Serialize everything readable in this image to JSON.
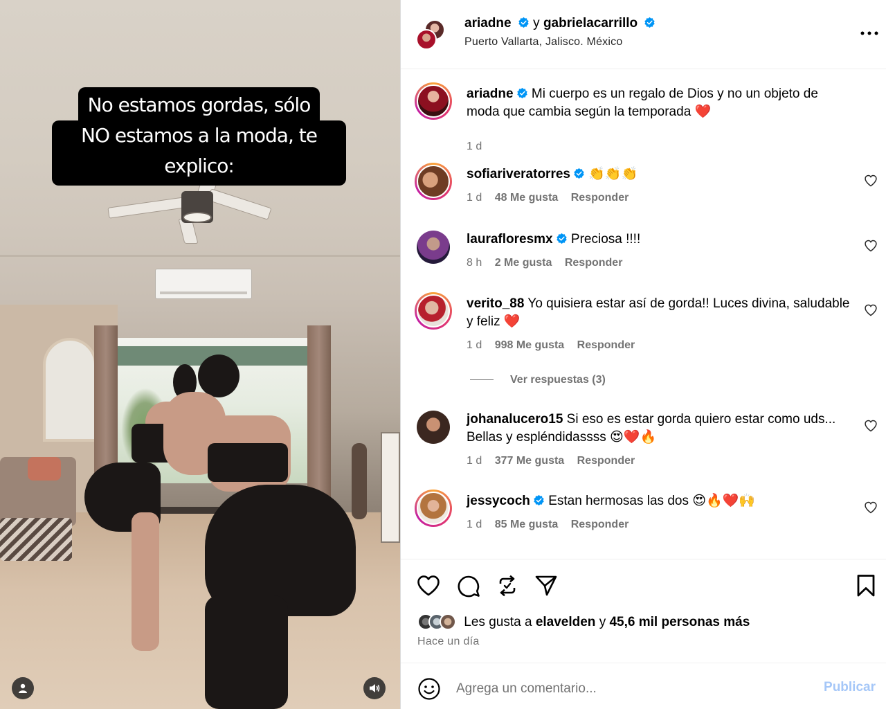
{
  "media": {
    "overlay_line1": "No estamos gordas, sólo",
    "overlay_line2": "NO estamos a la moda, te explico:"
  },
  "header": {
    "user1": "ariadne",
    "connector": "y",
    "user2": "gabrielacarrillo",
    "location": "Puerto Vallarta, Jalisco. México"
  },
  "caption": {
    "user": "ariadne",
    "text": "Mi cuerpo es un regalo de Dios y no un objeto de moda que cambia según la temporada ❤️",
    "time": "1 d"
  },
  "comments": [
    {
      "user": "sofiariveratorres",
      "verified": true,
      "text": "👏👏👏",
      "time": "1 d",
      "likes": "48 Me gusta",
      "reply": "Responder"
    },
    {
      "user": "laurafloresmx",
      "verified": true,
      "text": "Preciosa !!!!",
      "time": "8 h",
      "likes": "2 Me gusta",
      "reply": "Responder"
    },
    {
      "user": "verito_88",
      "verified": false,
      "text": "Yo quisiera estar así de gorda!! Luces divina, saludable y feliz ❤️",
      "time": "1 d",
      "likes": "998 Me gusta",
      "reply": "Responder",
      "view_replies": "Ver respuestas (3)"
    },
    {
      "user": "johanalucero15",
      "verified": false,
      "text": "Si eso es estar gorda quiero estar como uds... Bellas y espléndidassss 😍❤️🔥",
      "time": "1 d",
      "likes": "377 Me gusta",
      "reply": "Responder"
    },
    {
      "user": "jessycoch",
      "verified": true,
      "text": "Estan hermosas las dos 😍🔥❤️🙌",
      "time": "1 d",
      "likes": "85 Me gusta",
      "reply": "Responder"
    }
  ],
  "likes": {
    "prefix": "Les gusta a",
    "user": "elavelden",
    "connector": "y",
    "others": "45,6 mil personas más"
  },
  "time_ago": "Hace un día",
  "add_comment": {
    "placeholder": "Agrega un comentario...",
    "publish": "Publicar"
  },
  "colors": {
    "verified": "#0095f6",
    "publish_disabled": "#a5c7f8",
    "meta_gray": "#737373",
    "heart_red": "#ed4956"
  }
}
